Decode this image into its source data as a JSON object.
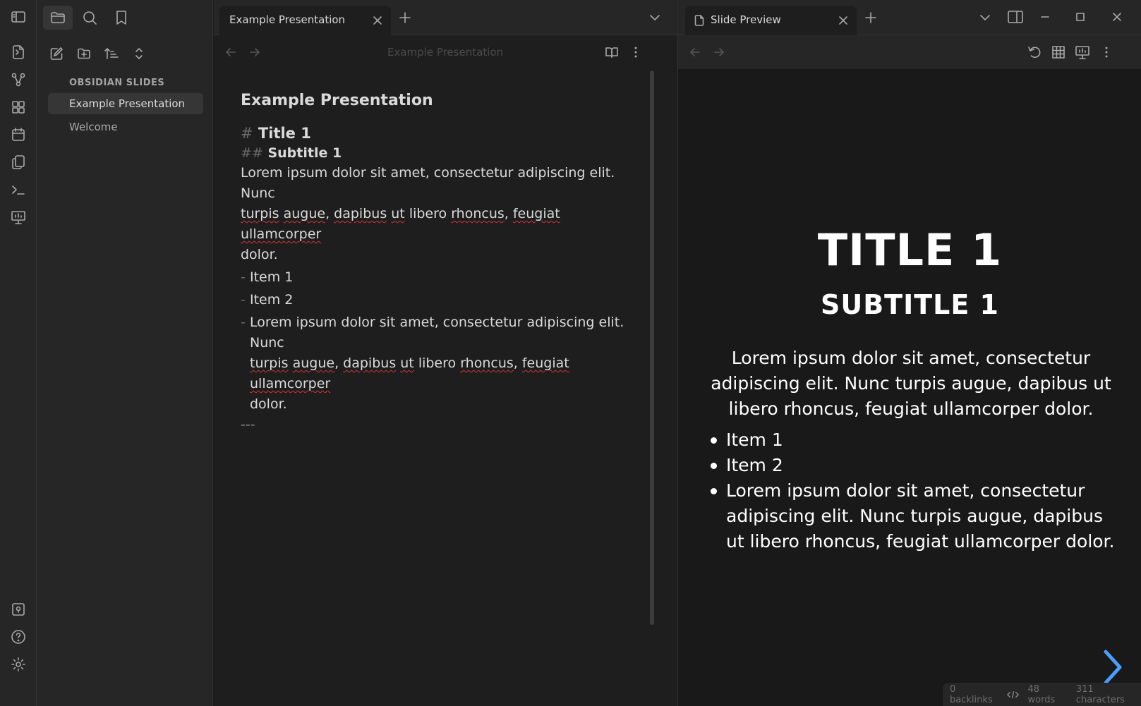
{
  "ribbon": {
    "icons": [
      "sidebar-toggle-icon",
      "open-quick-switcher-icon",
      "graph-view-icon",
      "canvas-icon",
      "calendar-icon",
      "templates-icon",
      "command-palette-icon",
      "slides-icon",
      "vault-switcher-icon",
      "help-icon",
      "settings-icon"
    ]
  },
  "sidebar": {
    "tabs": [
      "files-icon",
      "search-icon",
      "bookmark-icon"
    ],
    "tools": [
      "new-note-icon",
      "new-folder-icon",
      "sort-icon",
      "collapse-icon"
    ],
    "vault_name": "OBSIDIAN SLIDES",
    "files": [
      "Example Presentation",
      "Welcome"
    ]
  },
  "editor": {
    "tab_title": "Example Presentation",
    "header_title": "Example Presentation",
    "note_title": "Example Presentation",
    "h1_mark": "#",
    "h1_text": "Title 1",
    "h2_mark": "##",
    "h2_text": "Subtitle 1",
    "para_line1": "Lorem ipsum dolor sit amet, consectetur adipiscing elit. Nunc",
    "para_line2_words": [
      "turpis",
      "augue",
      "dapibus",
      "ut",
      "libero",
      "rhoncus",
      "feugiat",
      "ullamcorper"
    ],
    "para_line3": "dolor.",
    "list_dash": "-",
    "item1": "Item 1",
    "item2": "Item 2",
    "item3_line1": "Lorem ipsum dolor sit amet, consectetur adipiscing elit. Nunc",
    "item3_line3": "dolor.",
    "separator": "---",
    "comma": ","
  },
  "preview": {
    "tab_title": "Slide Preview",
    "slide_title": "TITLE 1",
    "slide_subtitle": "SUBTITLE 1",
    "slide_para": "Lorem ipsum dolor sit amet, consectetur adipiscing elit. Nunc turpis augue, dapibus ut libero rhoncus, feugiat ullamcorper dolor.",
    "slide_items": [
      "Item 1",
      "Item 2",
      "Lorem ipsum dolor sit amet, consectetur adipiscing elit. Nunc turpis augue, dapibus ut libero rhoncus, feugiat ullamcorper dolor."
    ]
  },
  "status": {
    "backlinks": "0 backlinks",
    "words": "48 words",
    "characters": "311 characters"
  },
  "colors": {
    "accent": "#4a9eff",
    "spellcheck": "#d13438"
  }
}
